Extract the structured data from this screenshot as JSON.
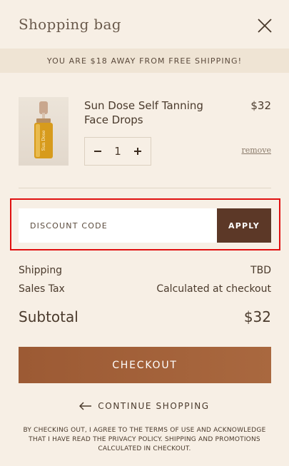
{
  "header": {
    "title": "Shopping bag"
  },
  "banner": {
    "text": "YOU ARE $18 AWAY FROM FREE SHIPPING!"
  },
  "item": {
    "name": "Sun Dose Self Tanning Face Drops",
    "price": "$32",
    "quantity": "1",
    "remove_label": "remove",
    "image_label": "Sun Dose"
  },
  "discount": {
    "placeholder": "DISCOUNT CODE",
    "apply_label": "APPLY"
  },
  "summary": {
    "shipping_label": "Shipping",
    "shipping_value": "TBD",
    "tax_label": "Sales Tax",
    "tax_value": "Calculated at checkout",
    "subtotal_label": "Subtotal",
    "subtotal_value": "$32"
  },
  "actions": {
    "checkout_label": "CHECKOUT",
    "continue_label": "CONTINUE SHOPPING"
  },
  "legal": {
    "text": "BY CHECKING OUT, I AGREE TO THE TERMS OF USE AND ACKNOWLEDGE THAT I HAVE READ THE PRIVACY POLICY. SHIPPING AND PROMOTIONS CALCULATED IN CHECKOUT."
  },
  "colors": {
    "background": "#f7efe5",
    "banner": "#efe4d4",
    "apply": "#5c3827",
    "checkout": "#a0603a",
    "highlight": "#e01010"
  },
  "icons": {
    "close": "close-icon",
    "minus": "minus-icon",
    "plus": "plus-icon",
    "back": "arrow-left-icon"
  }
}
